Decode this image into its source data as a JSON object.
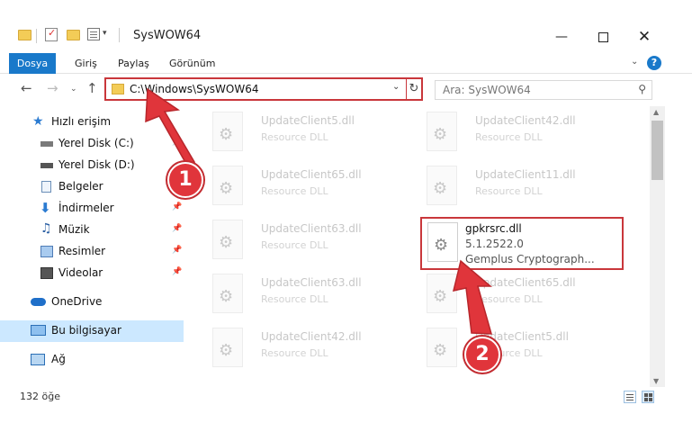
{
  "window": {
    "title": "SysWOW64"
  },
  "ribbon": {
    "tabs": [
      "Dosya",
      "Giriş",
      "Paylaş",
      "Görünüm"
    ]
  },
  "address": {
    "path": "C:\\Windows\\SysWOW64"
  },
  "search": {
    "placeholder": "Ara: SysWOW64"
  },
  "sidebar": {
    "items": [
      {
        "label": "Hızlı erişim",
        "icon": "star-icon"
      },
      {
        "label": "Yerel Disk (C:)",
        "icon": "drive-icon"
      },
      {
        "label": "Yerel Disk (D:)",
        "icon": "drive-icon"
      },
      {
        "label": "Belgeler",
        "icon": "documents-icon"
      },
      {
        "label": "İndirmeler",
        "icon": "download-icon"
      },
      {
        "label": "Müzik",
        "icon": "music-icon"
      },
      {
        "label": "Resimler",
        "icon": "pictures-icon"
      },
      {
        "label": "Videolar",
        "icon": "video-icon"
      },
      {
        "label": "OneDrive",
        "icon": "cloud-icon"
      },
      {
        "label": "Bu bilgisayar",
        "icon": "computer-icon"
      },
      {
        "label": "Ağ",
        "icon": "network-icon"
      }
    ]
  },
  "files": [
    {
      "name": "UpdateClient5.dll",
      "type": "Resource DLL"
    },
    {
      "name": "UpdateClient42.dll",
      "type": "Resource DLL"
    },
    {
      "name": "UpdateClient65.dll",
      "type": "Resource DLL"
    },
    {
      "name": "UpdateClient11.dll",
      "type": "Resource DLL"
    },
    {
      "name": "UpdateClient63.dll",
      "type": "Resource DLL"
    },
    {
      "name": "UpdateClient63.dll",
      "type": "Resource DLL"
    },
    {
      "name": "UpdateClient65.dll",
      "type": "Resource DLL"
    },
    {
      "name": "UpdateClient42.dll",
      "type": "Resource DLL"
    },
    {
      "name": "UpdateClient5.dll",
      "type": "Resource DLL"
    }
  ],
  "highlighted_file": {
    "name": "gpkrsrc.dll",
    "version": "5.1.2522.0",
    "description": "Gemplus Cryptograph..."
  },
  "status": {
    "item_count": "132 öğe"
  },
  "annotations": {
    "step1": "1",
    "step2": "2",
    "color": "#e0353b"
  }
}
